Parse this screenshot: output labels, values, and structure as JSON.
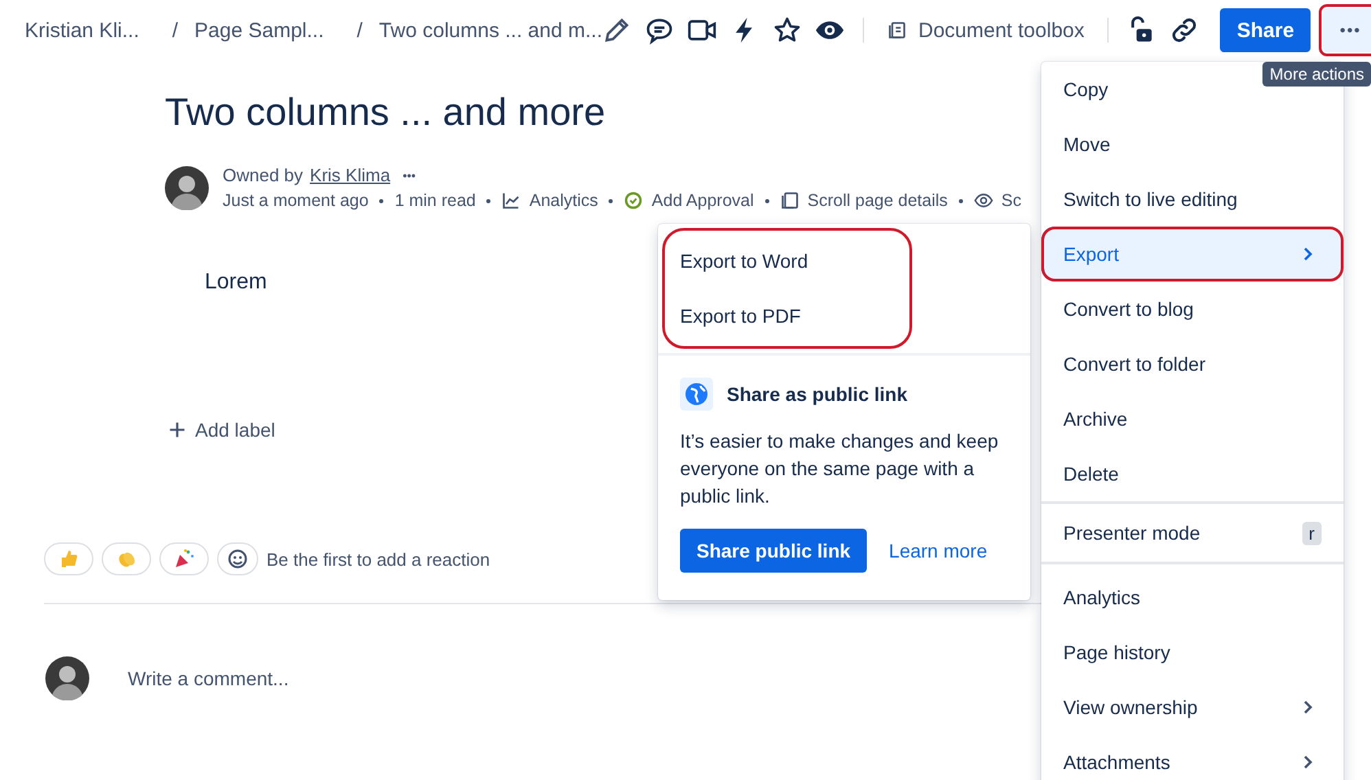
{
  "breadcrumbs": [
    {
      "label": "Kristian Kli..."
    },
    {
      "separator": "/",
      "label": "Page Sampl..."
    },
    {
      "separator": "/",
      "label": "Two columns ... and m..."
    }
  ],
  "toolbar": {
    "toolbox_label": "Document toolbox",
    "share_button": "Share",
    "more_button": {
      "label": "•••",
      "annotated": true
    },
    "tooltip": "More actions"
  },
  "page": {
    "title": "Two columns ... and more",
    "owner_prefix": "Owned by",
    "owner": "Kris Klima",
    "owner_more": "•••",
    "meta": [
      {
        "kind": "text",
        "label": "Just a moment ago"
      },
      {
        "kind": "text",
        "label": "1 min read"
      },
      {
        "kind": "analytics",
        "label": "Analytics"
      },
      {
        "kind": "approval",
        "label": "Add Approval"
      },
      {
        "kind": "scroll",
        "label": "Scroll page details"
      },
      {
        "kind": "eye",
        "label": "Sc"
      }
    ],
    "body": "Lorem",
    "add_label": "Add label",
    "reaction_prompt": "Be the first to add a reaction",
    "comment_placeholder": "Write a comment..."
  },
  "menu": {
    "sections": [
      [
        {
          "label": "Copy",
          "selected": false,
          "submenu": false,
          "annotated": false
        },
        {
          "label": "Move",
          "selected": false,
          "submenu": false,
          "annotated": false
        },
        {
          "label": "Switch to live editing",
          "selected": false,
          "submenu": false,
          "annotated": false
        },
        {
          "label": "Export",
          "selected": true,
          "submenu": true,
          "annotated": true
        },
        {
          "label": "Convert to blog",
          "selected": false,
          "submenu": false,
          "annotated": false
        },
        {
          "label": "Convert to folder",
          "selected": false,
          "submenu": false,
          "annotated": false
        },
        {
          "label": "Archive",
          "selected": false,
          "submenu": false,
          "annotated": false
        },
        {
          "label": "Delete",
          "selected": false,
          "submenu": false,
          "annotated": false
        }
      ],
      [
        {
          "label": "Presenter mode",
          "shortcut": "r",
          "selected": false,
          "submenu": false,
          "annotated": false
        }
      ],
      [
        {
          "label": "Analytics",
          "selected": false,
          "submenu": false,
          "annotated": false
        },
        {
          "label": "Page history",
          "selected": false,
          "submenu": false,
          "annotated": false
        },
        {
          "label": "View ownership",
          "selected": false,
          "submenu": true,
          "annotated": false
        },
        {
          "label": "Attachments",
          "selected": false,
          "submenu": true,
          "annotated": false
        }
      ]
    ]
  },
  "submenu": {
    "items": [
      "Export to Word",
      "Export to PDF"
    ],
    "annotated": true,
    "promo": {
      "title": "Share as public link",
      "text": "It’s easier to make changes and keep everyone on the same page with a public link.",
      "primary": "Share public link",
      "secondary": "Learn more"
    }
  }
}
